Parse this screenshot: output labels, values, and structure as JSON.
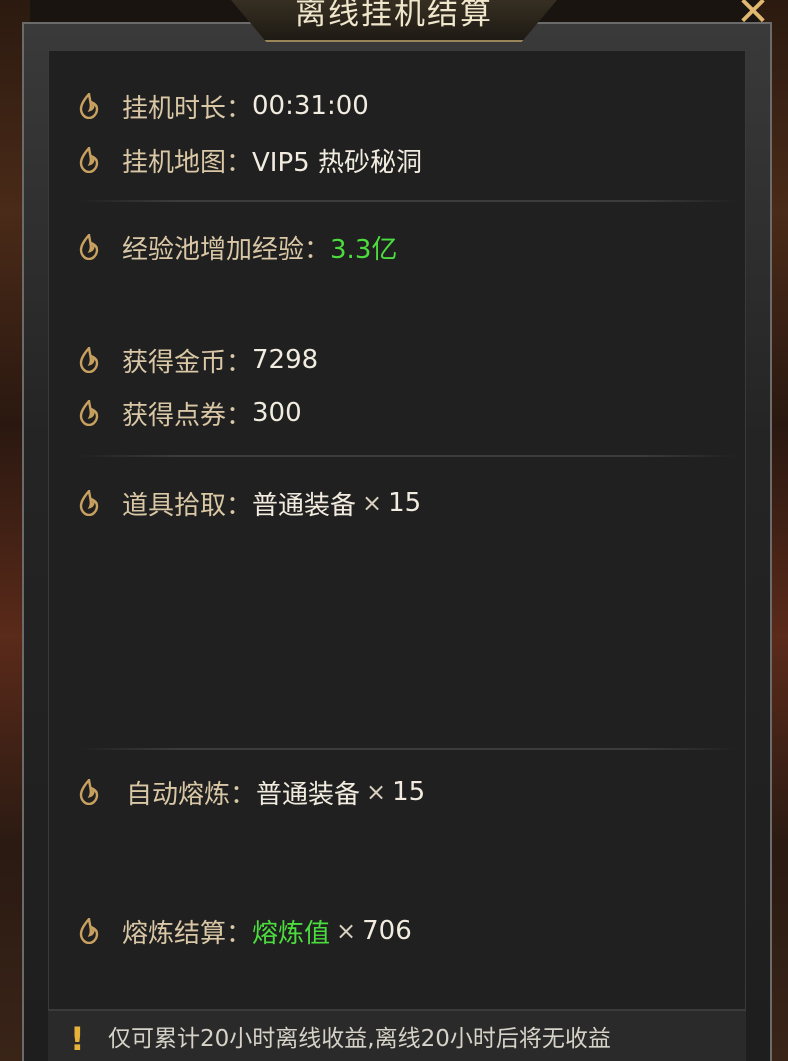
{
  "window": {
    "title": "离线挂机结算",
    "close_icon": "close-x-icon"
  },
  "rows": {
    "duration": {
      "label": "挂机时长：",
      "value": "00:31:00"
    },
    "map": {
      "label": "挂机地图：",
      "value": "VIP5 热砂秘洞"
    },
    "exp": {
      "label": "经验池增加经验：",
      "value": "3.3亿"
    },
    "gold": {
      "label": "获得金币：",
      "value": "7298"
    },
    "coupon": {
      "label": "获得点券：",
      "value": "300"
    },
    "items": {
      "label": "道具拾取：",
      "name": "普通装备",
      "mult": "×",
      "count": "15"
    },
    "smelt": {
      "label": "自动熔炼：",
      "name": "普通装备",
      "mult": "×",
      "count": "15"
    },
    "smelt_result": {
      "label": "熔炼结算：",
      "name": "熔炼值",
      "mult": "×",
      "count": "706"
    }
  },
  "footer": {
    "notice": "仅可累计20小时离线收益,离线20小时后将无收益",
    "icon": "exclamation-icon"
  },
  "colors": {
    "highlight_green": "#4bdc3e",
    "label_gold": "#d9c7a6",
    "flame_icon": "#c8a060"
  }
}
